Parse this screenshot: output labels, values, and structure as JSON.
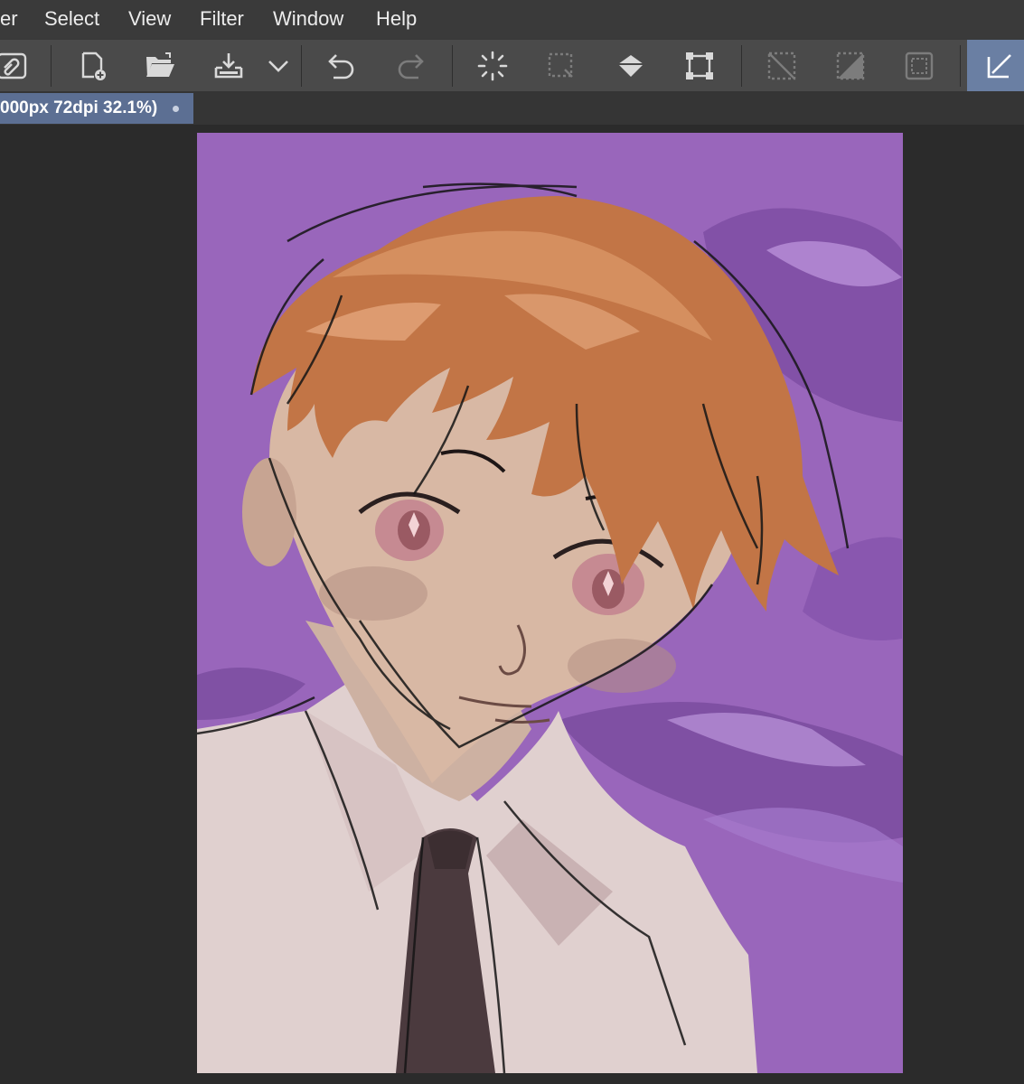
{
  "menu": {
    "items": [
      "er",
      "Select",
      "View",
      "Filter",
      "Window",
      "Help"
    ]
  },
  "toolbar": {
    "buttons": [
      {
        "name": "cloud-icon"
      },
      {
        "name": "new-document-icon"
      },
      {
        "name": "open-folder-icon"
      },
      {
        "name": "save-icon"
      },
      {
        "name": "chevron-down-icon"
      },
      {
        "name": "undo-icon"
      },
      {
        "name": "redo-icon"
      },
      {
        "name": "loading-icon"
      },
      {
        "name": "dotted-square-icon"
      },
      {
        "name": "fill-bucket-icon"
      },
      {
        "name": "transform-icon"
      },
      {
        "name": "clear-selection-icon"
      },
      {
        "name": "invert-selection-icon"
      },
      {
        "name": "selection-border-icon"
      },
      {
        "name": "selection-tool-icon"
      }
    ],
    "active_color": "#6a7fa3"
  },
  "tab": {
    "title": "000px 72dpi 32.1%)"
  },
  "canvas": {
    "background": "#9966bb",
    "description_colors": {
      "hair": "#c67a4a",
      "skin": "#d7b7a2",
      "shirt": "#e2d2d2",
      "tie": "#4a3a3e"
    }
  }
}
